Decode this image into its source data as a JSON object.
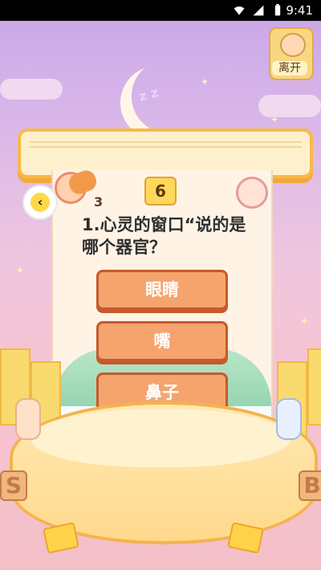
{
  "status_bar": {
    "time": "9:41"
  },
  "header": {
    "exit_label": "离开"
  },
  "game": {
    "round": "6",
    "left_score": "3",
    "question": "1.心灵的窗口“说的是哪个器官？",
    "options": [
      "眼睛",
      "嘴",
      "鼻子"
    ]
  },
  "icons": {
    "back": "back-arrow-icon",
    "exit": "exit-icon",
    "wifi": "wifi-icon",
    "signal": "signal-icon",
    "battery": "battery-icon"
  }
}
